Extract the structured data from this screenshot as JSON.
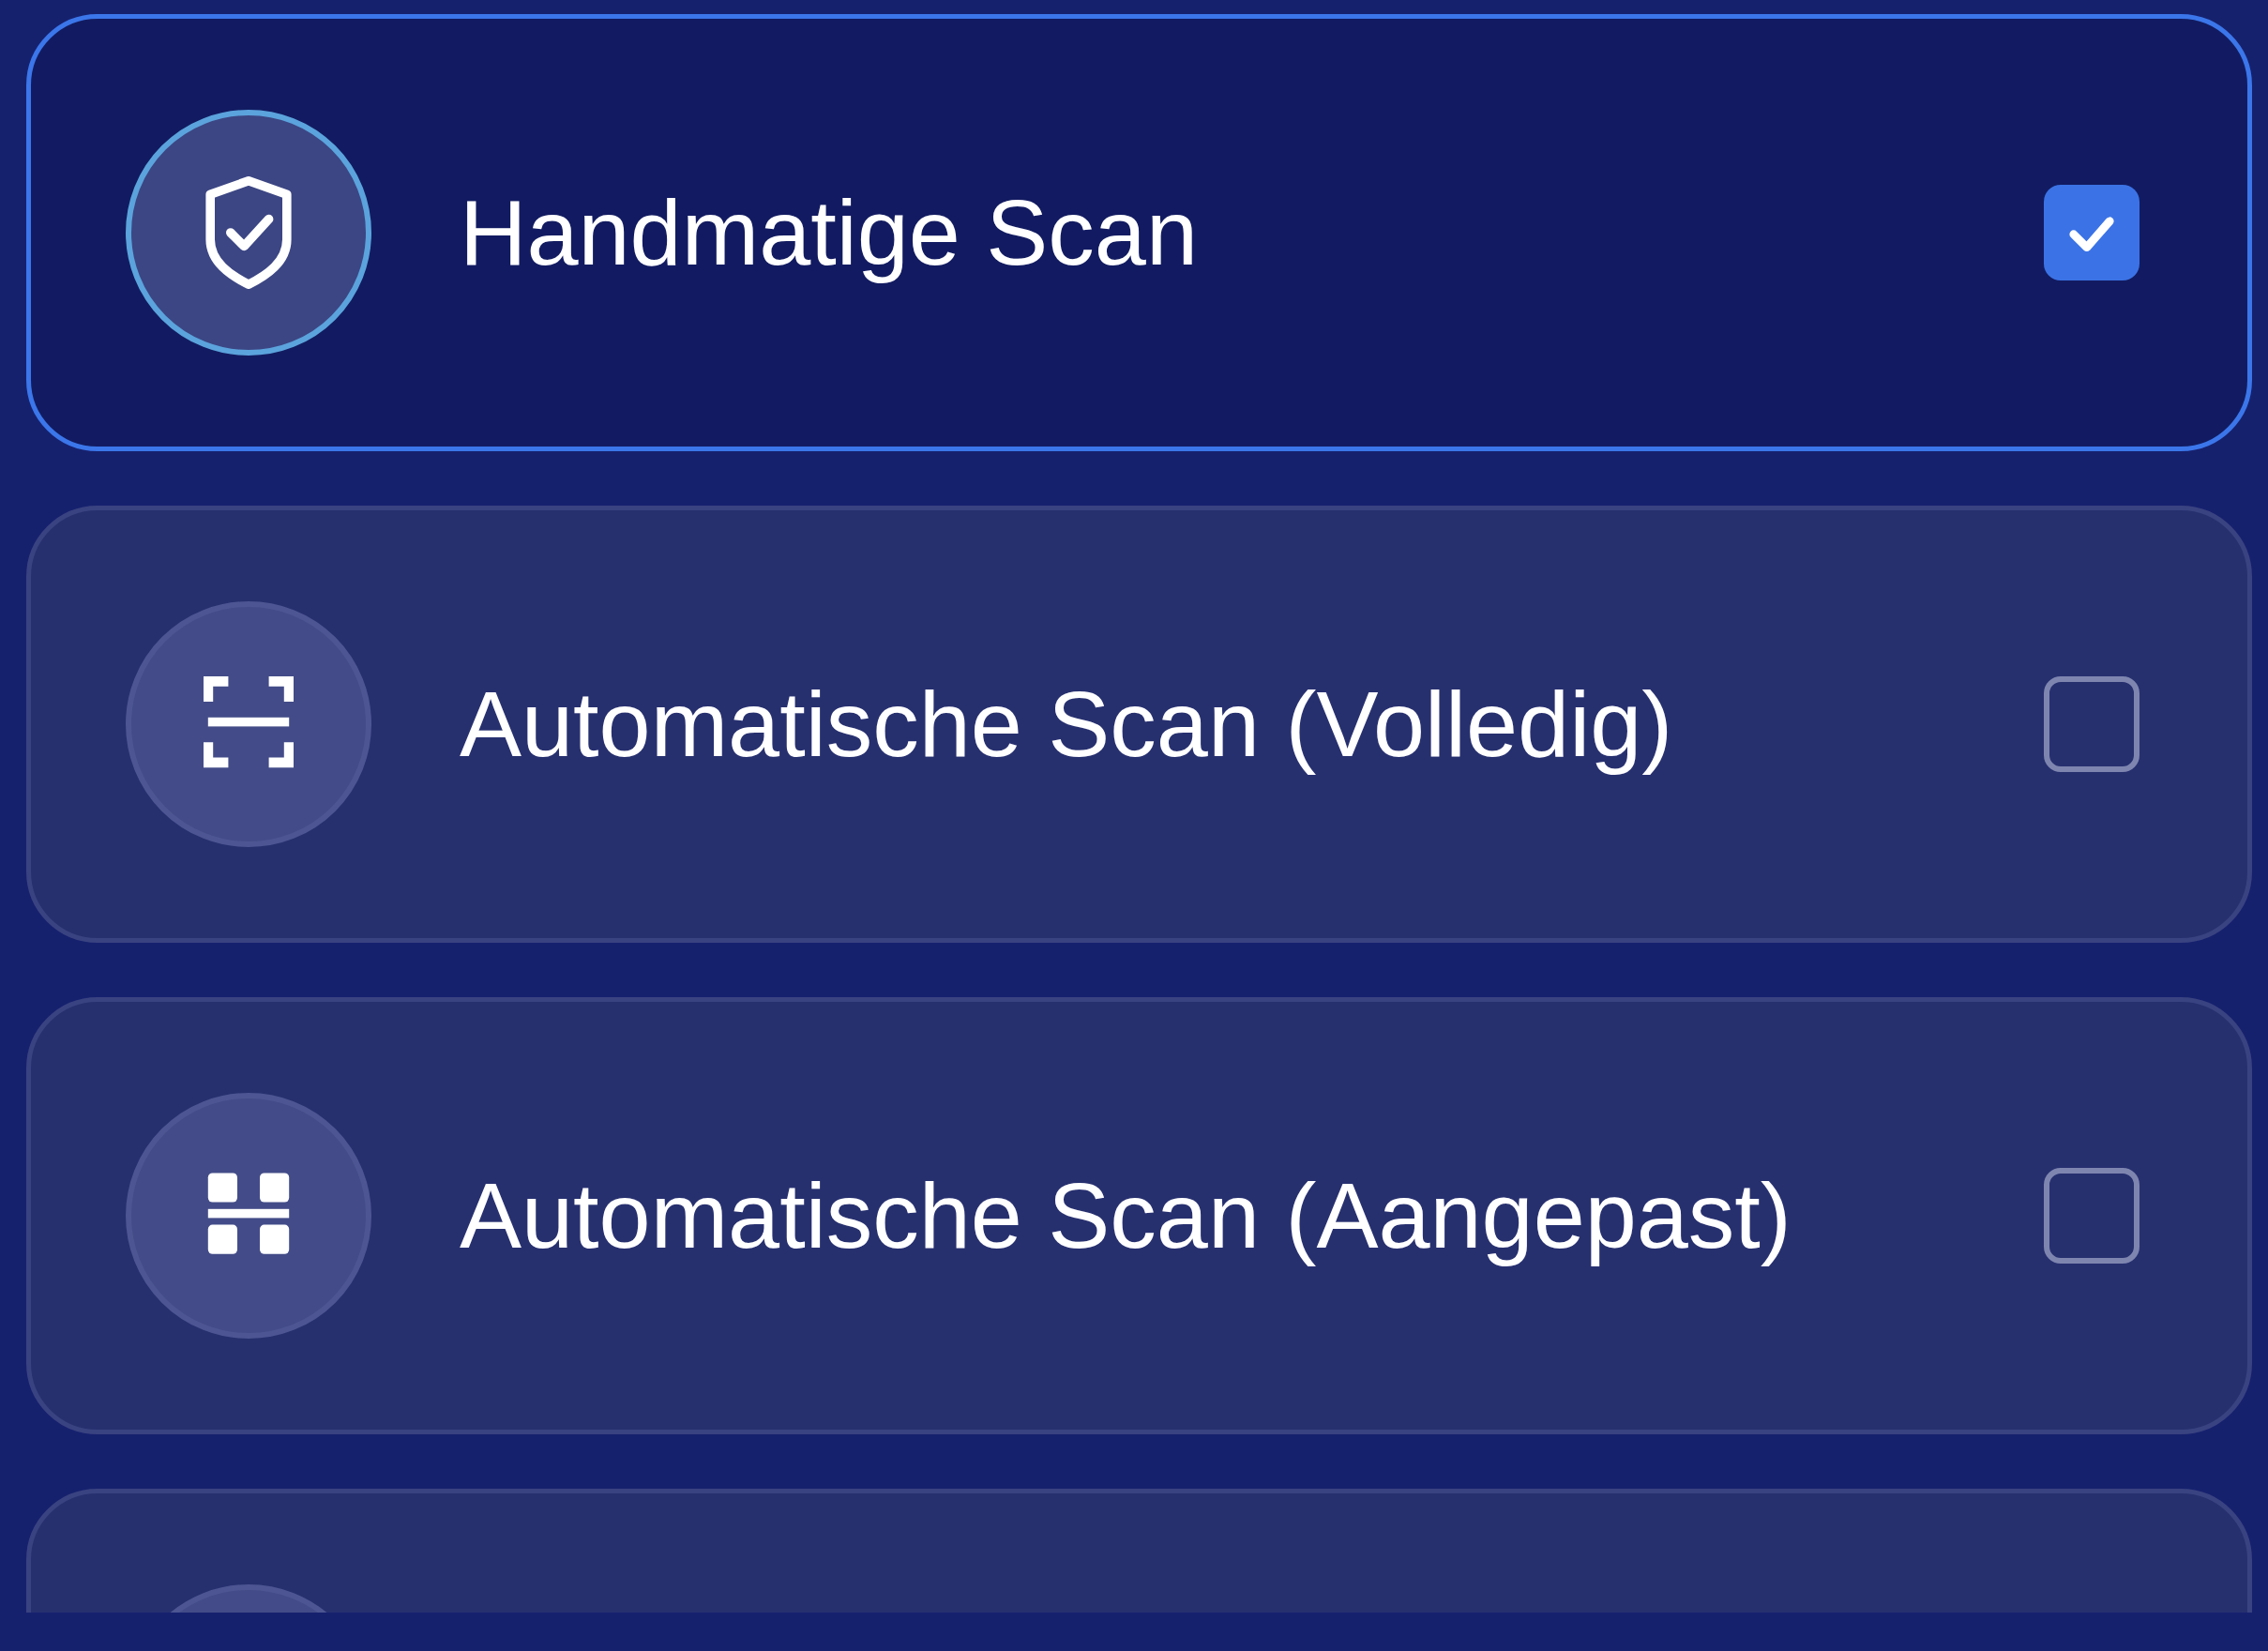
{
  "options": [
    {
      "kind": "shield",
      "label": "Handmatige Scan",
      "checked": true
    },
    {
      "kind": "scan",
      "label": "Automatische Scan (Volledig)",
      "checked": false
    },
    {
      "kind": "grid",
      "label": "Automatische Scan (Aangepast)",
      "checked": false
    }
  ]
}
